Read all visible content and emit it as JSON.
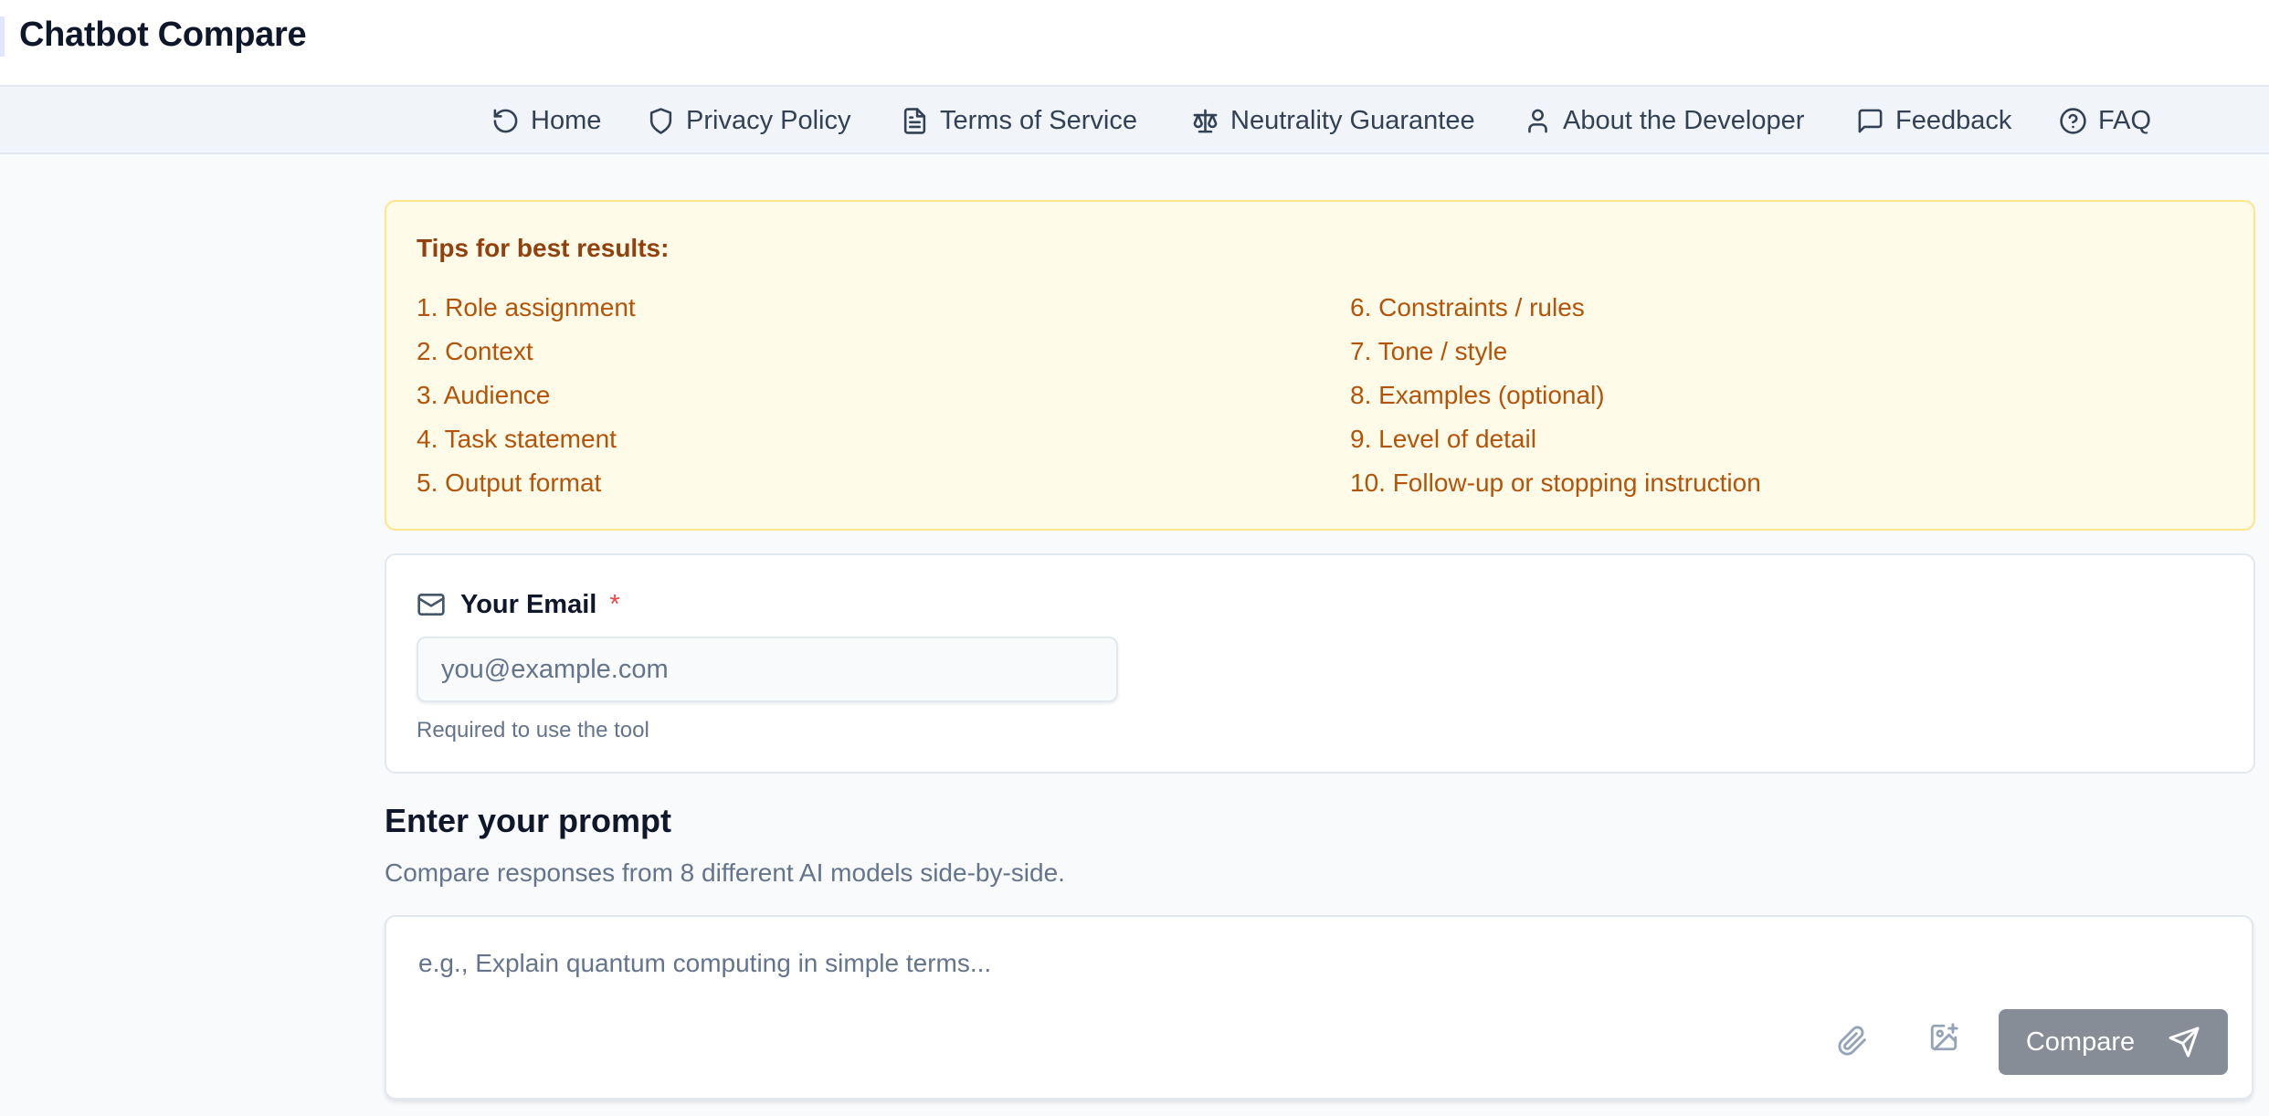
{
  "app": {
    "title": "Chatbot Compare"
  },
  "nav": {
    "items": [
      {
        "label": "Home",
        "icon": "rotate-ccw-icon"
      },
      {
        "label": "Privacy Policy",
        "icon": "shield-icon"
      },
      {
        "label": "Terms of Service",
        "icon": "file-text-icon"
      },
      {
        "label": "Neutrality Guarantee",
        "icon": "scale-icon"
      },
      {
        "label": "About the Developer",
        "icon": "user-icon"
      },
      {
        "label": "Feedback",
        "icon": "message-square-icon"
      },
      {
        "label": "FAQ",
        "icon": "help-circle-icon"
      }
    ]
  },
  "tips": {
    "title": "Tips for best results:",
    "items": [
      "1. Role assignment",
      "2. Context",
      "3. Audience",
      "4. Task statement",
      "5. Output format",
      "6. Constraints / rules",
      "7. Tone / style",
      "8. Examples (optional)",
      "9. Level of detail",
      "10. Follow-up or stopping instruction"
    ]
  },
  "email": {
    "label": "Your Email",
    "required_marker": "*",
    "placeholder": "you@example.com",
    "value": "",
    "help": "Required to use the tool"
  },
  "prompt": {
    "heading": "Enter your prompt",
    "subheading": "Compare responses from 8 different AI models side-by-side.",
    "placeholder": "e.g., Explain quantum computing in simple terms...",
    "value": "",
    "compare_label": "Compare"
  },
  "colors": {
    "tips_background": "#fefce8",
    "tips_border": "#fde68a",
    "tips_text": "#b45309",
    "required": "#ef4444",
    "compare_button": "#878d96"
  }
}
